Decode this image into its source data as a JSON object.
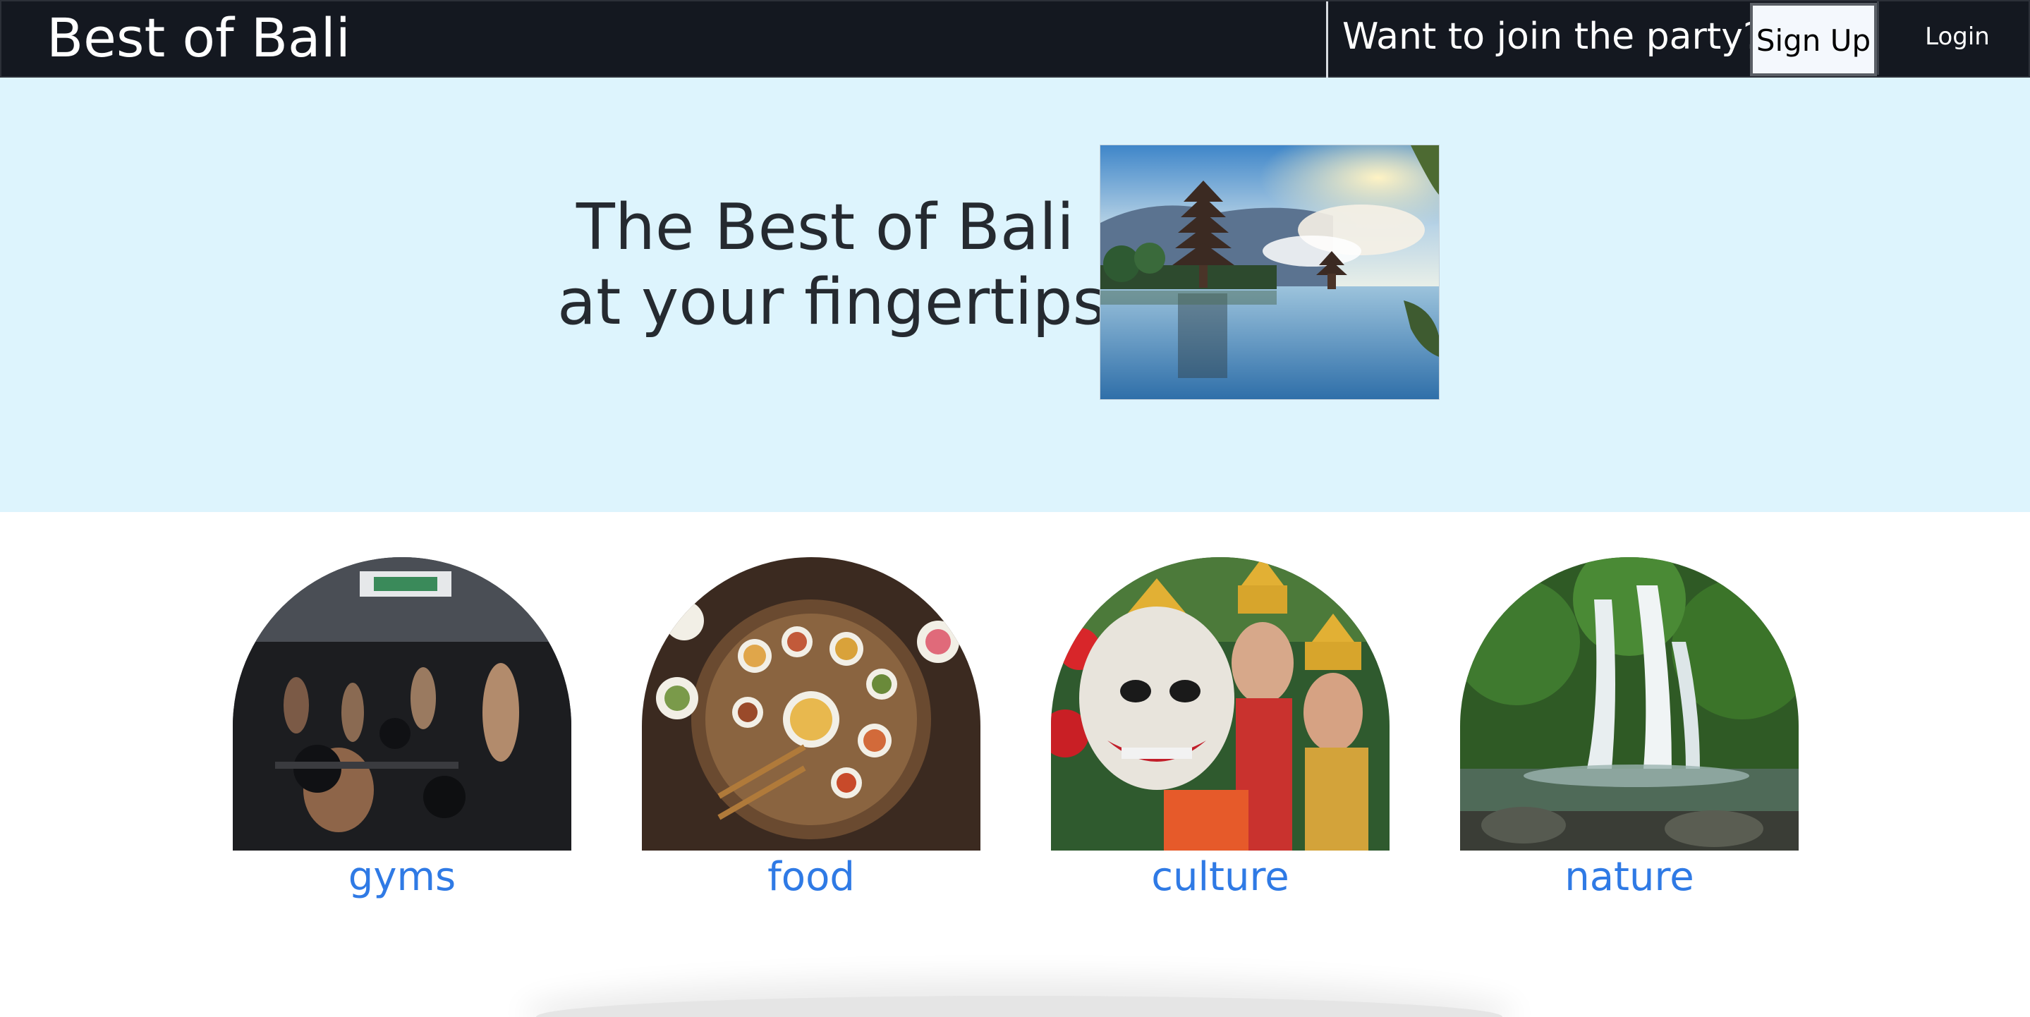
{
  "navbar": {
    "brand": "Best of Bali",
    "cta_text": "Want to join the party?",
    "signup_label": "Sign Up",
    "login_label": "Login"
  },
  "hero": {
    "title_line1": "The Best of Bali",
    "title_line2": "at your fingertips",
    "image_subject": "temple-on-lake-photo"
  },
  "categories": [
    {
      "label": "gyms",
      "image_subject": "gym-photo"
    },
    {
      "label": "food",
      "image_subject": "food-platter-photo"
    },
    {
      "label": "culture",
      "image_subject": "balinese-dancers-photo"
    },
    {
      "label": "nature",
      "image_subject": "waterfall-photo"
    }
  ],
  "colors": {
    "navbar_bg": "#141820",
    "hero_bg": "#ddf4fd",
    "category_link": "#2f7ae5",
    "heading_text": "#252a30"
  }
}
